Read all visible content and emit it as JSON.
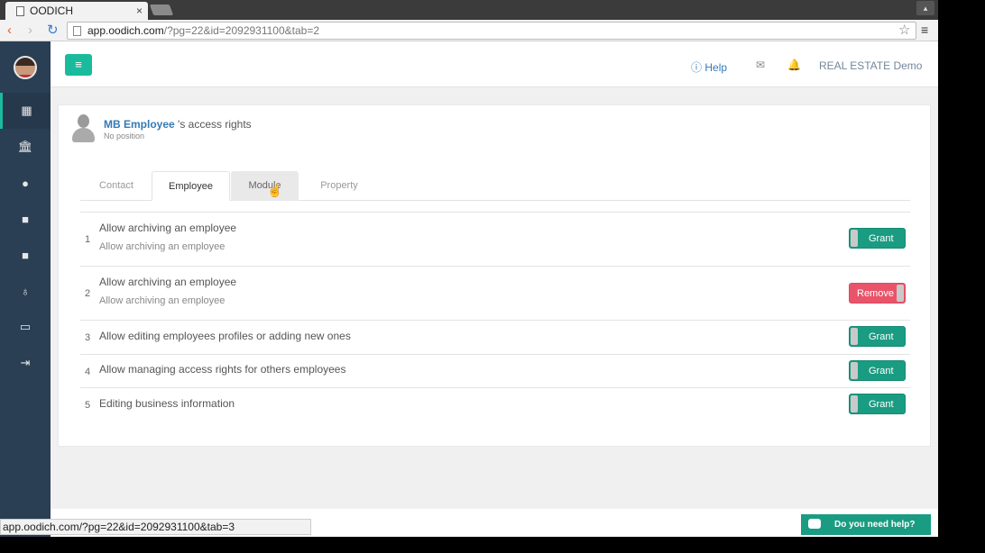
{
  "browser": {
    "tab_title": "OODICH",
    "tab_close": "×",
    "url_host": "app.oodich.com",
    "url_path": "/?pg=22&id=2092931100&tab=2",
    "status_url": "app.oodich.com/?pg=22&id=2092931100&tab=3",
    "win_btn": "▴"
  },
  "topnav": {
    "menu_icon": "≡",
    "help_label": "Help",
    "help_icon": "ⓘ",
    "mail_icon": "✉",
    "bell_icon": "🔔",
    "user_label": "REAL ESTATE Demo"
  },
  "sidebar": {
    "items": [
      {
        "icon": "dashboard-icon",
        "glyph": "▦"
      },
      {
        "icon": "bank-icon",
        "glyph": "🏛"
      },
      {
        "icon": "user-icon",
        "glyph": "●"
      },
      {
        "icon": "square-icon",
        "glyph": "■"
      },
      {
        "icon": "square-icon",
        "glyph": "■"
      },
      {
        "icon": "key-icon",
        "glyph": "♁"
      },
      {
        "icon": "laptop-icon",
        "glyph": "▭"
      },
      {
        "icon": "signout-icon",
        "glyph": "⇥"
      }
    ]
  },
  "header": {
    "employee_name": "MB Employee",
    "title_suffix": "'s access rights",
    "subtitle": "No position"
  },
  "tabs": [
    {
      "label": "Contact"
    },
    {
      "label": "Employee"
    },
    {
      "label": "Module"
    },
    {
      "label": "Property"
    }
  ],
  "rights": [
    {
      "num": "1",
      "label": "Allow archiving an employee",
      "desc": "Allow archiving an employee",
      "action": "Grant"
    },
    {
      "num": "2",
      "label": "Allow archiving an employee",
      "desc": "Allow archiving an employee",
      "action": "Remove"
    },
    {
      "num": "3",
      "label": "Allow editing employees profiles or adding new ones",
      "desc": "",
      "action": "Grant"
    },
    {
      "num": "4",
      "label": "Allow managing access rights for others employees",
      "desc": "",
      "action": "Grant"
    },
    {
      "num": "5",
      "label": "Editing business information",
      "desc": "",
      "action": "Grant"
    }
  ],
  "help_chat": {
    "label": "Do you need help?"
  },
  "colors": {
    "accent": "#1abb9c",
    "grant": "#1a9c82",
    "remove": "#e9546b",
    "sidebar": "#2a3f54",
    "link": "#337ab7"
  }
}
